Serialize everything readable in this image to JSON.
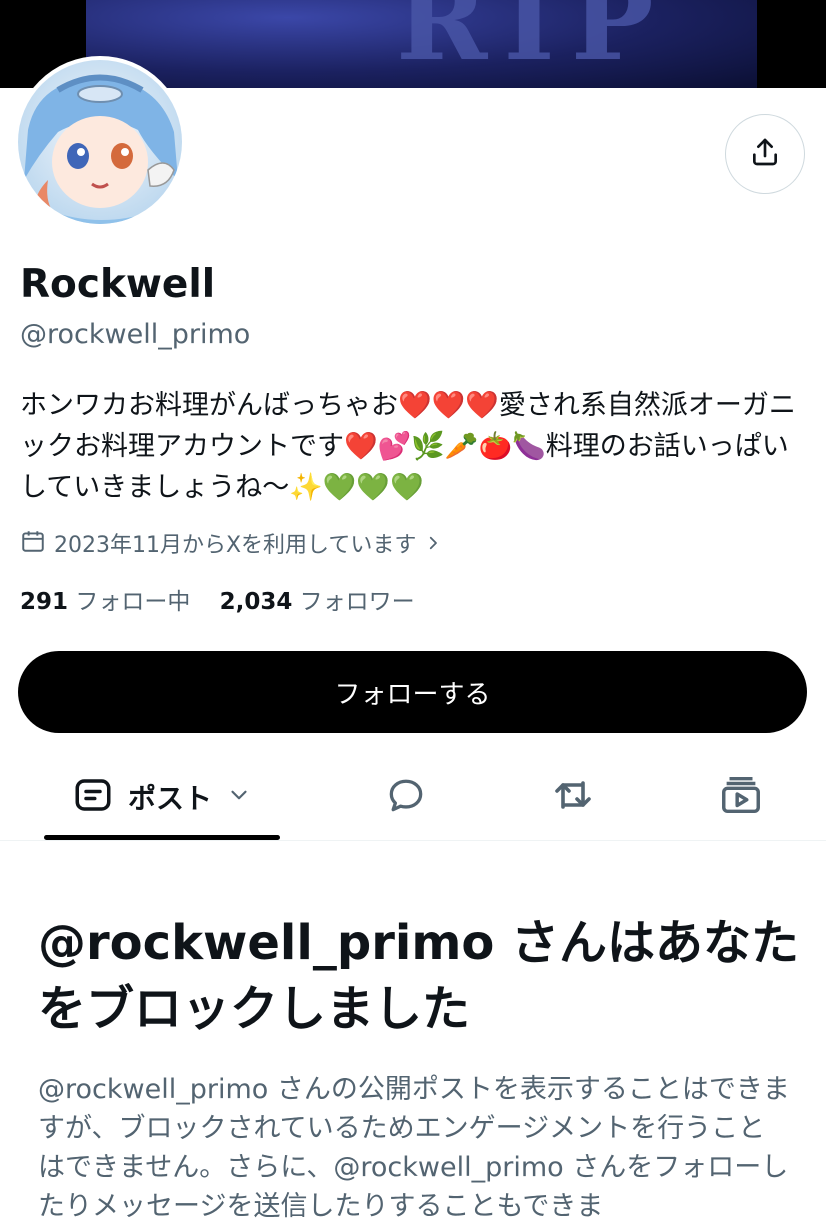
{
  "banner": {
    "text": "RIP"
  },
  "profile": {
    "name": "Rockwell",
    "handle": "@rockwell_primo",
    "bio": "ホンワカお料理がんばっちゃお❤️❤️❤️愛され系自然派オーガニックお料理アカウントです❤️💕🌿🥕🍅🍆料理のお話いっぱいしていきましょうね〜✨💚💚💚",
    "joined": "2023年11月からXを利用しています",
    "following_count": "291",
    "following_label": "フォロー中",
    "followers_count": "2,034",
    "followers_label": "フォロワー"
  },
  "actions": {
    "follow_label": "フォローする"
  },
  "tabs": {
    "posts_label": "ポスト"
  },
  "blocked": {
    "title": "@rockwell_primo さんはあなたをブロックしました",
    "message": "@rockwell_primo さんの公開ポストを表示することはできますが、ブロックされているためエンゲージメントを行うことはできません。さらに、@rockwell_primo さんをフォローしたりメッセージを送信したりすることもできま"
  },
  "icons": [
    "share-icon",
    "calendar-icon",
    "chevron-right-icon",
    "posts-icon",
    "chevron-down-icon",
    "reply-icon",
    "repost-icon",
    "media-icon"
  ]
}
